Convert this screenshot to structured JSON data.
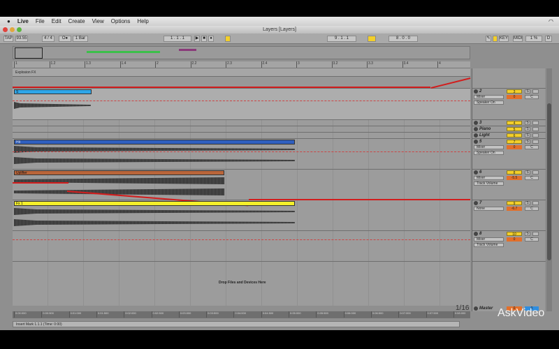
{
  "menu": {
    "apple": "",
    "items": [
      "Live",
      "File",
      "Edit",
      "Create",
      "View",
      "Options",
      "Help"
    ]
  },
  "window": {
    "title": "Layers  [Layers]"
  },
  "transport": {
    "tap": "TAP",
    "tempo": "93.55",
    "meter": "4 / 4",
    "metro": "O●",
    "quantize": "1 Bar",
    "position": "1 . 1 . 1",
    "loop_start": "9 . 1 . 1",
    "loop_length": "8 . 0 . 0",
    "key": "KEY",
    "midi": "MIDI",
    "cpu": "1 %",
    "disk": "D"
  },
  "ruler": {
    "ticks": [
      "1",
      "1.2",
      "1.3",
      "1.4",
      "2",
      "2.2",
      "2.3",
      "2.4",
      "3",
      "3.2",
      "3.3",
      "3.4",
      "4"
    ]
  },
  "time_ruler": {
    "ticks": [
      "0:00:000",
      "0:00:500",
      "0:01:000",
      "0:01:500",
      "0:02:000",
      "0:02:500",
      "0:03:000",
      "0:03:500",
      "0:04:000",
      "0:04:500",
      "0:05:000",
      "0:05:500",
      "0:06:000",
      "0:06:500",
      "0:07:000",
      "0:07:500",
      "0:08:000"
    ]
  },
  "group": {
    "name": "Explosion FX"
  },
  "clips": {
    "s": "S",
    "hit": "Hit",
    "uplifter": "Uplifter",
    "fx1": "Fx 1"
  },
  "drop_hint": "Drop Files and Devices Here",
  "zoom_fraction": "1/16",
  "tracks": [
    {
      "name": "2",
      "number": "3",
      "device": "Mixer",
      "param": "Speaker On",
      "vol": "0",
      "pan": "C"
    },
    {
      "name": "3",
      "number": "4"
    },
    {
      "name": "Piano",
      "number": "5"
    },
    {
      "name": "Light",
      "number": "6"
    },
    {
      "name": "5",
      "number": "7",
      "device": "Mixer",
      "param": "Speaker On",
      "vol": "0",
      "pan": "C"
    },
    {
      "name": "6",
      "number": "8",
      "device": "Mixer",
      "param": "Track Volume",
      "vol": "-5.5",
      "pan": "C"
    },
    {
      "name": "7",
      "number": "9",
      "device": "None",
      "vol": "-6.7",
      "pan": "C"
    },
    {
      "name": "8",
      "number": "10",
      "device": "Mixer",
      "param": "Track Volume",
      "vol": "0",
      "pan": "C"
    }
  ],
  "master": {
    "name": "Master",
    "vol": "0",
    "pan": "0"
  },
  "solo": "S",
  "status": "Insert Mark 1.1.1 (Time: 0:00)",
  "watermark": "AskVideo",
  "colors": {
    "blue_clip": "#2fa6e8",
    "hit_clip": "#2f5fbf",
    "uplifter_clip": "#b9653a",
    "fx_clip": "#f5f02a",
    "automation": "#d21d1d",
    "track_num": "#f3cf2a"
  }
}
